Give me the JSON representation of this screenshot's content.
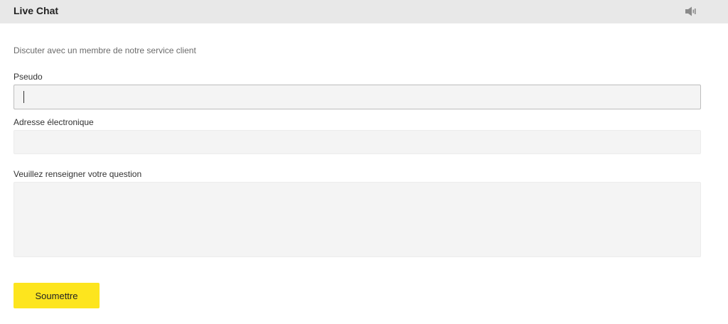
{
  "header": {
    "title": "Live Chat",
    "sound_icon": "speaker-icon"
  },
  "form": {
    "intro": "Discuter avec un membre de notre service client",
    "nickname": {
      "label": "Pseudo",
      "value": ""
    },
    "email": {
      "label": "Adresse électronique",
      "value": ""
    },
    "question": {
      "label": "Veuillez renseigner votre question",
      "value": ""
    },
    "submit_label": "Soumettre"
  },
  "colors": {
    "header_bg": "#e8e8e8",
    "field_bg": "#f4f4f4",
    "submit_bg": "#fde51e"
  }
}
